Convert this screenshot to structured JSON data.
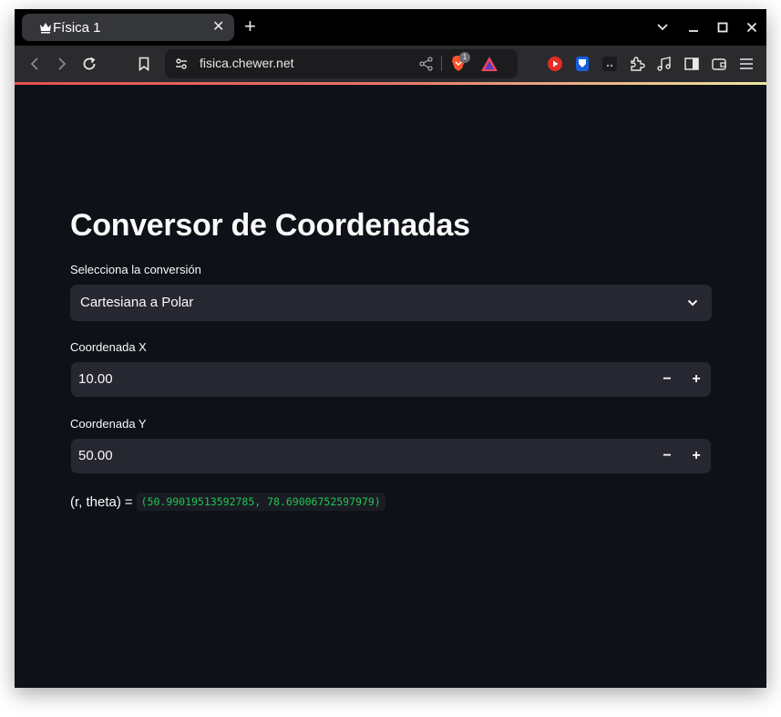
{
  "browser": {
    "tab_title": "Física 1",
    "tab_close_glyph": "✕",
    "new_tab_glyph": "+",
    "url": "fisica.chewer.net",
    "brave_shields_badge": "1",
    "icons": [
      "back-icon",
      "forward-icon",
      "reload-icon",
      "bookmark-icon",
      "site-settings-icon",
      "share-icon",
      "brave-shields-icon",
      "brave-rewards-icon",
      "youtube-extension-icon",
      "bitwarden-extension-icon",
      "extension-icon",
      "puzzle-extensions-icon",
      "media-icon",
      "sidebar-icon",
      "wallet-icon",
      "menu-icon"
    ]
  },
  "page": {
    "title": "Conversor de Coordenadas",
    "conversion_label": "Selecciona la conversión",
    "conversion_value": "Cartesiana a Polar",
    "x_label": "Coordenada X",
    "x_value": "10.00",
    "y_label": "Coordenada Y",
    "y_value": "50.00",
    "minus_glyph": "−",
    "plus_glyph": "+",
    "result_label": "(r, theta)",
    "result_equals": "=",
    "result_value": "(50.99019513592785, 78.69006752597979)"
  },
  "colors": {
    "background": "#0e1117",
    "input_bg": "#262730",
    "text": "#fafafa",
    "code_green": "#21c354"
  }
}
